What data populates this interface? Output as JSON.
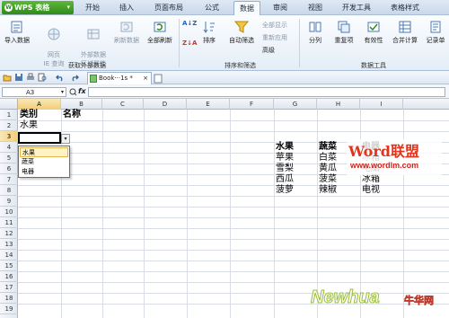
{
  "app": {
    "name": "WPS 表格"
  },
  "menu": [
    "开始",
    "插入",
    "页面布局",
    "公式",
    "数据",
    "审阅",
    "视图",
    "开发工具",
    "表格样式"
  ],
  "ribbon": {
    "import_data": "导入数据",
    "html_query": "网页\nIE 查询",
    "external_props": "外部数据\n区域属性",
    "refresh": "刷新数据",
    "refresh_all": "全部刷新",
    "group_external": "获取外部数据",
    "sort": "排序",
    "autofilter": "自动筛选",
    "show_all": "全部显示",
    "reapply": "重新应用",
    "advanced": "高级",
    "group_sort": "排序和筛选",
    "split": "分列",
    "duplicates": "重复项",
    "validation": "有效性",
    "merge_calc": "合并计算",
    "record": "记录单",
    "group_tools": "数据工具"
  },
  "doc_tab": "Book···1s *",
  "formula_bar": {
    "name_box": "A3",
    "fx": "fx",
    "content": ""
  },
  "columns": [
    "A",
    "B",
    "C",
    "D",
    "E",
    "F",
    "G",
    "H",
    "I"
  ],
  "rows": [
    "1",
    "2",
    "3",
    "4",
    "5",
    "6",
    "7",
    "8",
    "9",
    "10",
    "11",
    "12",
    "13",
    "14",
    "15",
    "16",
    "17",
    "18",
    "19"
  ],
  "cells": {
    "A1": "类别",
    "B1": "名称",
    "A2": "水果",
    "G4": "水果",
    "H4": "蔬菜",
    "I4": "电器",
    "G5": "苹果",
    "H5": "白菜",
    "I5": "冰箱",
    "G6": "雪梨",
    "H6": "黄瓜",
    "I6": "电脑",
    "G7": "西瓜",
    "H7": "菠菜",
    "I7": "冰箱",
    "G8": "菠萝",
    "H8": "辣椒",
    "I8": "电视"
  },
  "dropdown": {
    "options": [
      "水果",
      "蔬菜",
      "电器"
    ],
    "highlighted": "水果"
  },
  "watermarks": {
    "wordlm_logo": "Word联盟",
    "wordlm_url": "www.wordlm.com",
    "newhua": "Newhua",
    "newhua_cn": "牛华网"
  },
  "colors": {
    "accent": "#2f8a1c",
    "selection": "#f2cd77"
  }
}
